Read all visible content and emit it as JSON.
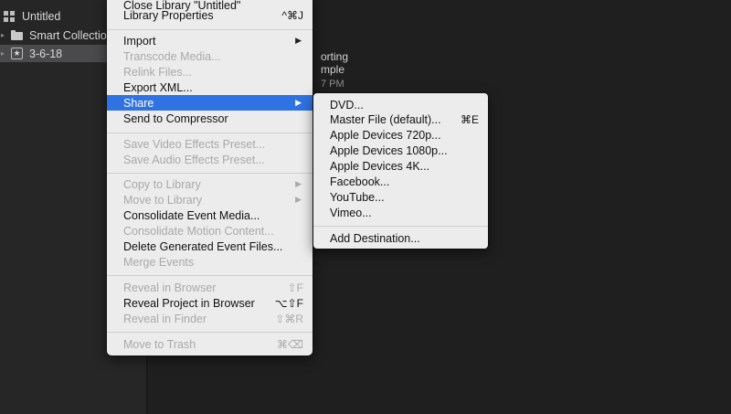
{
  "sidebar": {
    "items": [
      {
        "label": "Untitled",
        "icon": "library-grid-icon"
      },
      {
        "label": "Smart Collection",
        "icon": "folder-icon"
      },
      {
        "label": "3-6-18",
        "icon": "event-star-icon"
      }
    ]
  },
  "browser": {
    "clip_title_line1": "orting",
    "clip_title_line2": "mple",
    "clip_time": "7 PM"
  },
  "file_menu": {
    "items": [
      {
        "label": "Close Library \"Untitled\"",
        "shortcut": ""
      },
      {
        "label": "Library Properties",
        "shortcut": "^⌘J"
      },
      {
        "label": "Import",
        "submenu": true
      },
      {
        "label": "Transcode Media..."
      },
      {
        "label": "Relink Files..."
      },
      {
        "label": "Export XML..."
      },
      {
        "label": "Share",
        "submenu": true
      },
      {
        "label": "Send to Compressor"
      },
      {
        "label": "Save Video Effects Preset..."
      },
      {
        "label": "Save Audio Effects Preset..."
      },
      {
        "label": "Copy to Library",
        "submenu": true
      },
      {
        "label": "Move to Library",
        "submenu": true
      },
      {
        "label": "Consolidate Event Media..."
      },
      {
        "label": "Consolidate Motion Content..."
      },
      {
        "label": "Delete Generated Event Files..."
      },
      {
        "label": "Merge Events"
      },
      {
        "label": "Reveal in Browser",
        "shortcut": "⇧F"
      },
      {
        "label": "Reveal Project in Browser",
        "shortcut": "⌥⇧F"
      },
      {
        "label": "Reveal in Finder",
        "shortcut": "⇧⌘R"
      },
      {
        "label": "Move to Trash",
        "shortcut": "⌘⌫"
      }
    ]
  },
  "share_menu": {
    "items": [
      {
        "label": "DVD..."
      },
      {
        "label": "Master File (default)...",
        "shortcut": "⌘E"
      },
      {
        "label": "Apple Devices 720p..."
      },
      {
        "label": "Apple Devices 1080p..."
      },
      {
        "label": "Apple Devices 4K..."
      },
      {
        "label": "Facebook..."
      },
      {
        "label": "YouTube..."
      },
      {
        "label": "Vimeo..."
      },
      {
        "label": "Add Destination..."
      }
    ]
  },
  "colors": {
    "highlight": "#2f73e2",
    "menu_bg": "#ececec",
    "disabled_text": "#a9a9a9"
  }
}
